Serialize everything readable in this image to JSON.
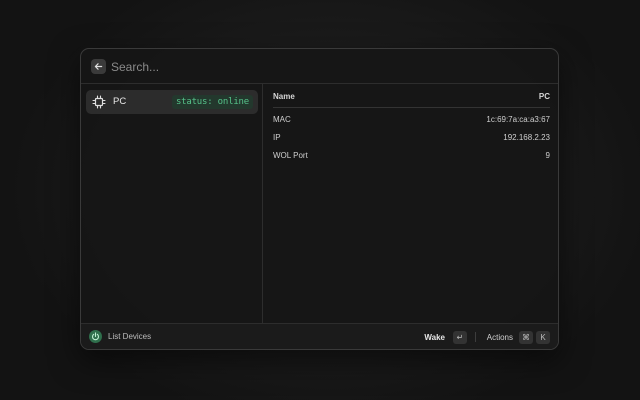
{
  "search": {
    "placeholder": "Search...",
    "value": ""
  },
  "list": {
    "items": [
      {
        "label": "PC",
        "status": "status: online",
        "icon": "chip-icon"
      }
    ]
  },
  "detail": {
    "header": {
      "key": "Name",
      "value": "PC"
    },
    "rows": [
      {
        "key": "MAC",
        "value": "1c:69:7a:ca:a3:67"
      },
      {
        "key": "IP",
        "value": "192.168.2.23"
      },
      {
        "key": "WOL Port",
        "value": "9"
      }
    ]
  },
  "footer": {
    "title": "List Devices",
    "icon": "power-icon",
    "primary_action": {
      "label": "Wake",
      "shortcut": "↵"
    },
    "secondary_action": {
      "label": "Actions",
      "keys": [
        "⌘",
        "K"
      ]
    }
  },
  "colors": {
    "status_green": "#56c28a",
    "accent_green": "#2f6f4c"
  }
}
